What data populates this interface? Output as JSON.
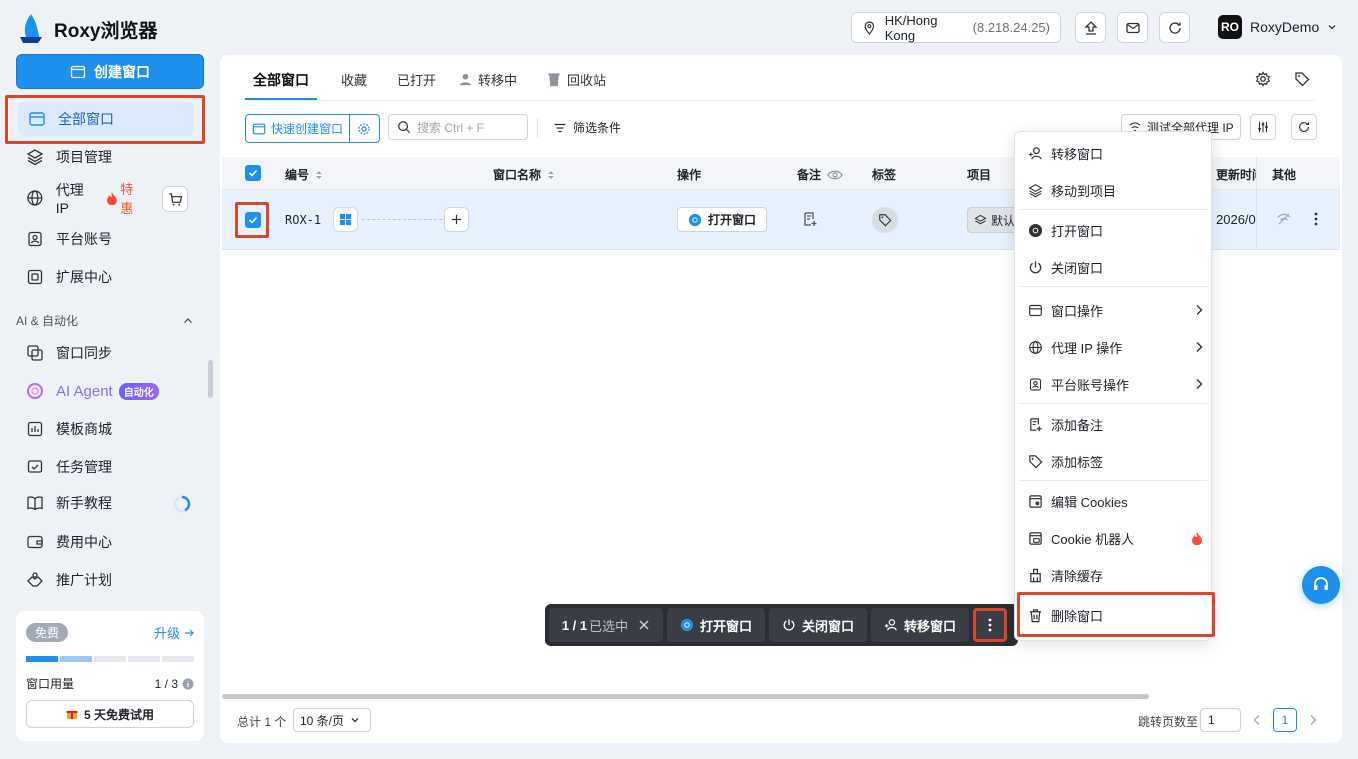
{
  "app": {
    "title": "Roxy浏览器"
  },
  "header": {
    "proxy_location": "HK/Hong Kong",
    "proxy_ip": "(8.218.24.25)",
    "avatar_initials": "RO",
    "username": "RoxyDemo"
  },
  "sidebar": {
    "create_button": "创建窗口",
    "items": [
      {
        "label": "全部窗口"
      },
      {
        "label": "项目管理"
      },
      {
        "label": "代理 IP"
      },
      {
        "label": "平台账号"
      },
      {
        "label": "扩展中心"
      }
    ],
    "proxy_hot": "特惠",
    "section_title": "AI & 自动化",
    "ai_items": [
      {
        "label": "窗口同步"
      },
      {
        "label": "AI Agent"
      },
      {
        "label": "模板商城"
      },
      {
        "label": "任务管理"
      },
      {
        "label": "新手教程"
      },
      {
        "label": "费用中心"
      },
      {
        "label": "推广计划"
      }
    ],
    "ai_badge": "自动化",
    "plan": {
      "tag": "免费",
      "upgrade": "升级",
      "usage_label": "窗口用量",
      "usage_value": "1 / 3",
      "usage_fraction": 0.333,
      "trial_button": "5 天免费试用"
    }
  },
  "tabs": [
    {
      "label": "全部窗口"
    },
    {
      "label": "收藏"
    },
    {
      "label": "已打开"
    },
    {
      "label": "转移中"
    },
    {
      "label": "回收站"
    }
  ],
  "toolbar": {
    "quick_create": "快速创建窗口",
    "search_placeholder": "搜索 Ctrl + F",
    "filter": "筛选条件",
    "test_proxy": "测试全部代理 IP"
  },
  "table": {
    "columns": {
      "id": "编号",
      "name": "窗口名称",
      "action": "操作",
      "note": "备注",
      "tag": "标签",
      "project": "项目",
      "updated": "更新时间",
      "other": "其他"
    },
    "rows": [
      {
        "id": "ROX-1",
        "open_button": "打开窗口",
        "project": "默认",
        "updated": "2026/0"
      }
    ]
  },
  "context_menu": {
    "items": [
      "转移窗口",
      "移动到项目",
      "打开窗口",
      "关闭窗口",
      "窗口操作",
      "代理 IP 操作",
      "平台账号操作",
      "添加备注",
      "添加标签",
      "编辑 Cookies",
      "Cookie 机器人",
      "清除缓存",
      "删除窗口"
    ]
  },
  "action_bar": {
    "selected_count": "1 / 1",
    "selected_label": "已选中",
    "open": "打开窗口",
    "close": "关闭窗口",
    "transfer": "转移窗口"
  },
  "footer": {
    "total": "总计 1 个",
    "page_size": "10 条/页",
    "jump_label": "跳转页数至",
    "jump_value": "1",
    "current_page": "1"
  },
  "colors": {
    "accent": "#1e90f0",
    "highlight_border": "#d9472b",
    "hot": "#ff4d2e"
  }
}
